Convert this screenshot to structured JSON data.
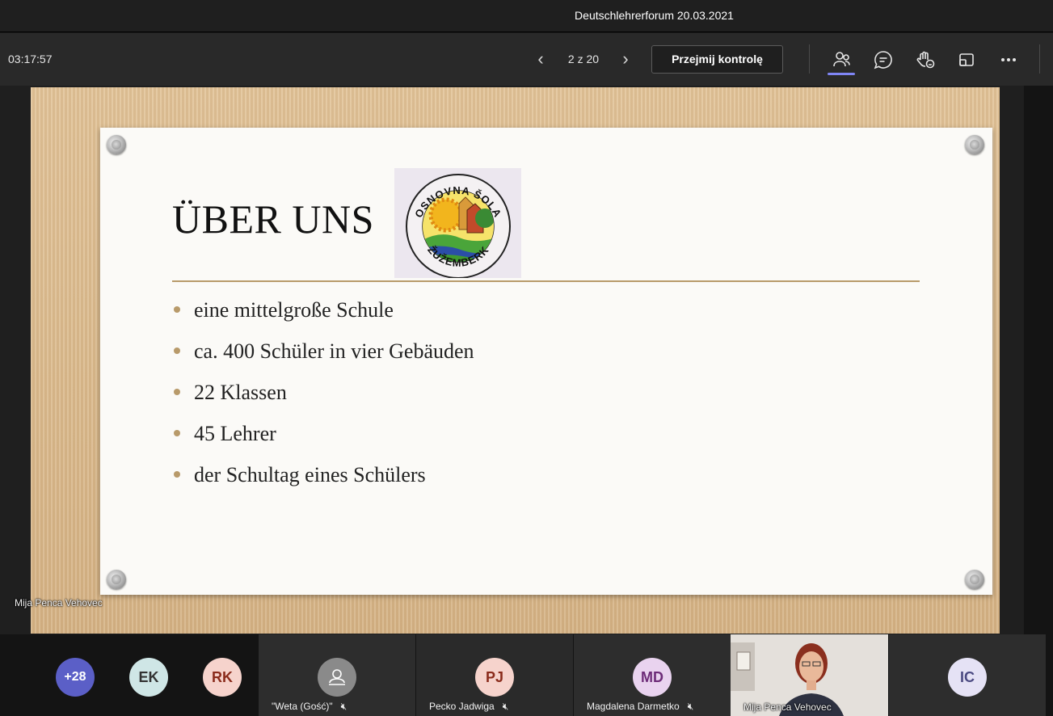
{
  "window": {
    "title": "Deutschlehrerforum 20.03.2021"
  },
  "toolbar": {
    "timer": "03:17:57",
    "page_counter": "2 z 20",
    "take_control_label": "Przejmij kontrolę",
    "icons": [
      "chevron-left-icon",
      "chevron-right-icon",
      "participants-icon",
      "chat-icon",
      "raise-hand-icon",
      "share-tray-icon",
      "more-icon"
    ]
  },
  "slide": {
    "title": "ÜBER UNS",
    "logo": {
      "top_text": "OSNOVNA ŠOLA",
      "bottom_text": "ŽUŽEMBERK"
    },
    "bullets": [
      "eine mittelgroße Schule",
      "ca. 400 Schüler in vier Gebäuden",
      "22 Klassen",
      "45 Lehrer",
      "der Schultag eines Schülers"
    ],
    "accent_color": "#b89a6a"
  },
  "presenter": {
    "name": "Mija Penca Vehovec"
  },
  "gallery": {
    "overflow_count": "+28",
    "avatars": [
      {
        "initials": "EK",
        "bg": "#cfe6e6",
        "fg": "#333333"
      },
      {
        "initials": "RK",
        "bg": "#f6d3cc",
        "fg": "#8a2b1b"
      }
    ],
    "tiles": [
      {
        "name": "\"Weta (Gość)\"",
        "initials": "",
        "bg": "#8a8a8a"
      },
      {
        "name": "Pecko Jadwiga",
        "initials": "PJ",
        "bg": "#f6d3cc",
        "fg": "#8a2b1b"
      },
      {
        "name": "Magdalena Darmetko",
        "initials": "MD",
        "bg": "#e9d3ef",
        "fg": "#6d2c78"
      }
    ],
    "video_tile": {
      "name": "Mija Penca Vehovec"
    },
    "last_tile": {
      "initials": "IC",
      "bg": "#e5e2f5",
      "fg": "#4b4a82"
    }
  }
}
